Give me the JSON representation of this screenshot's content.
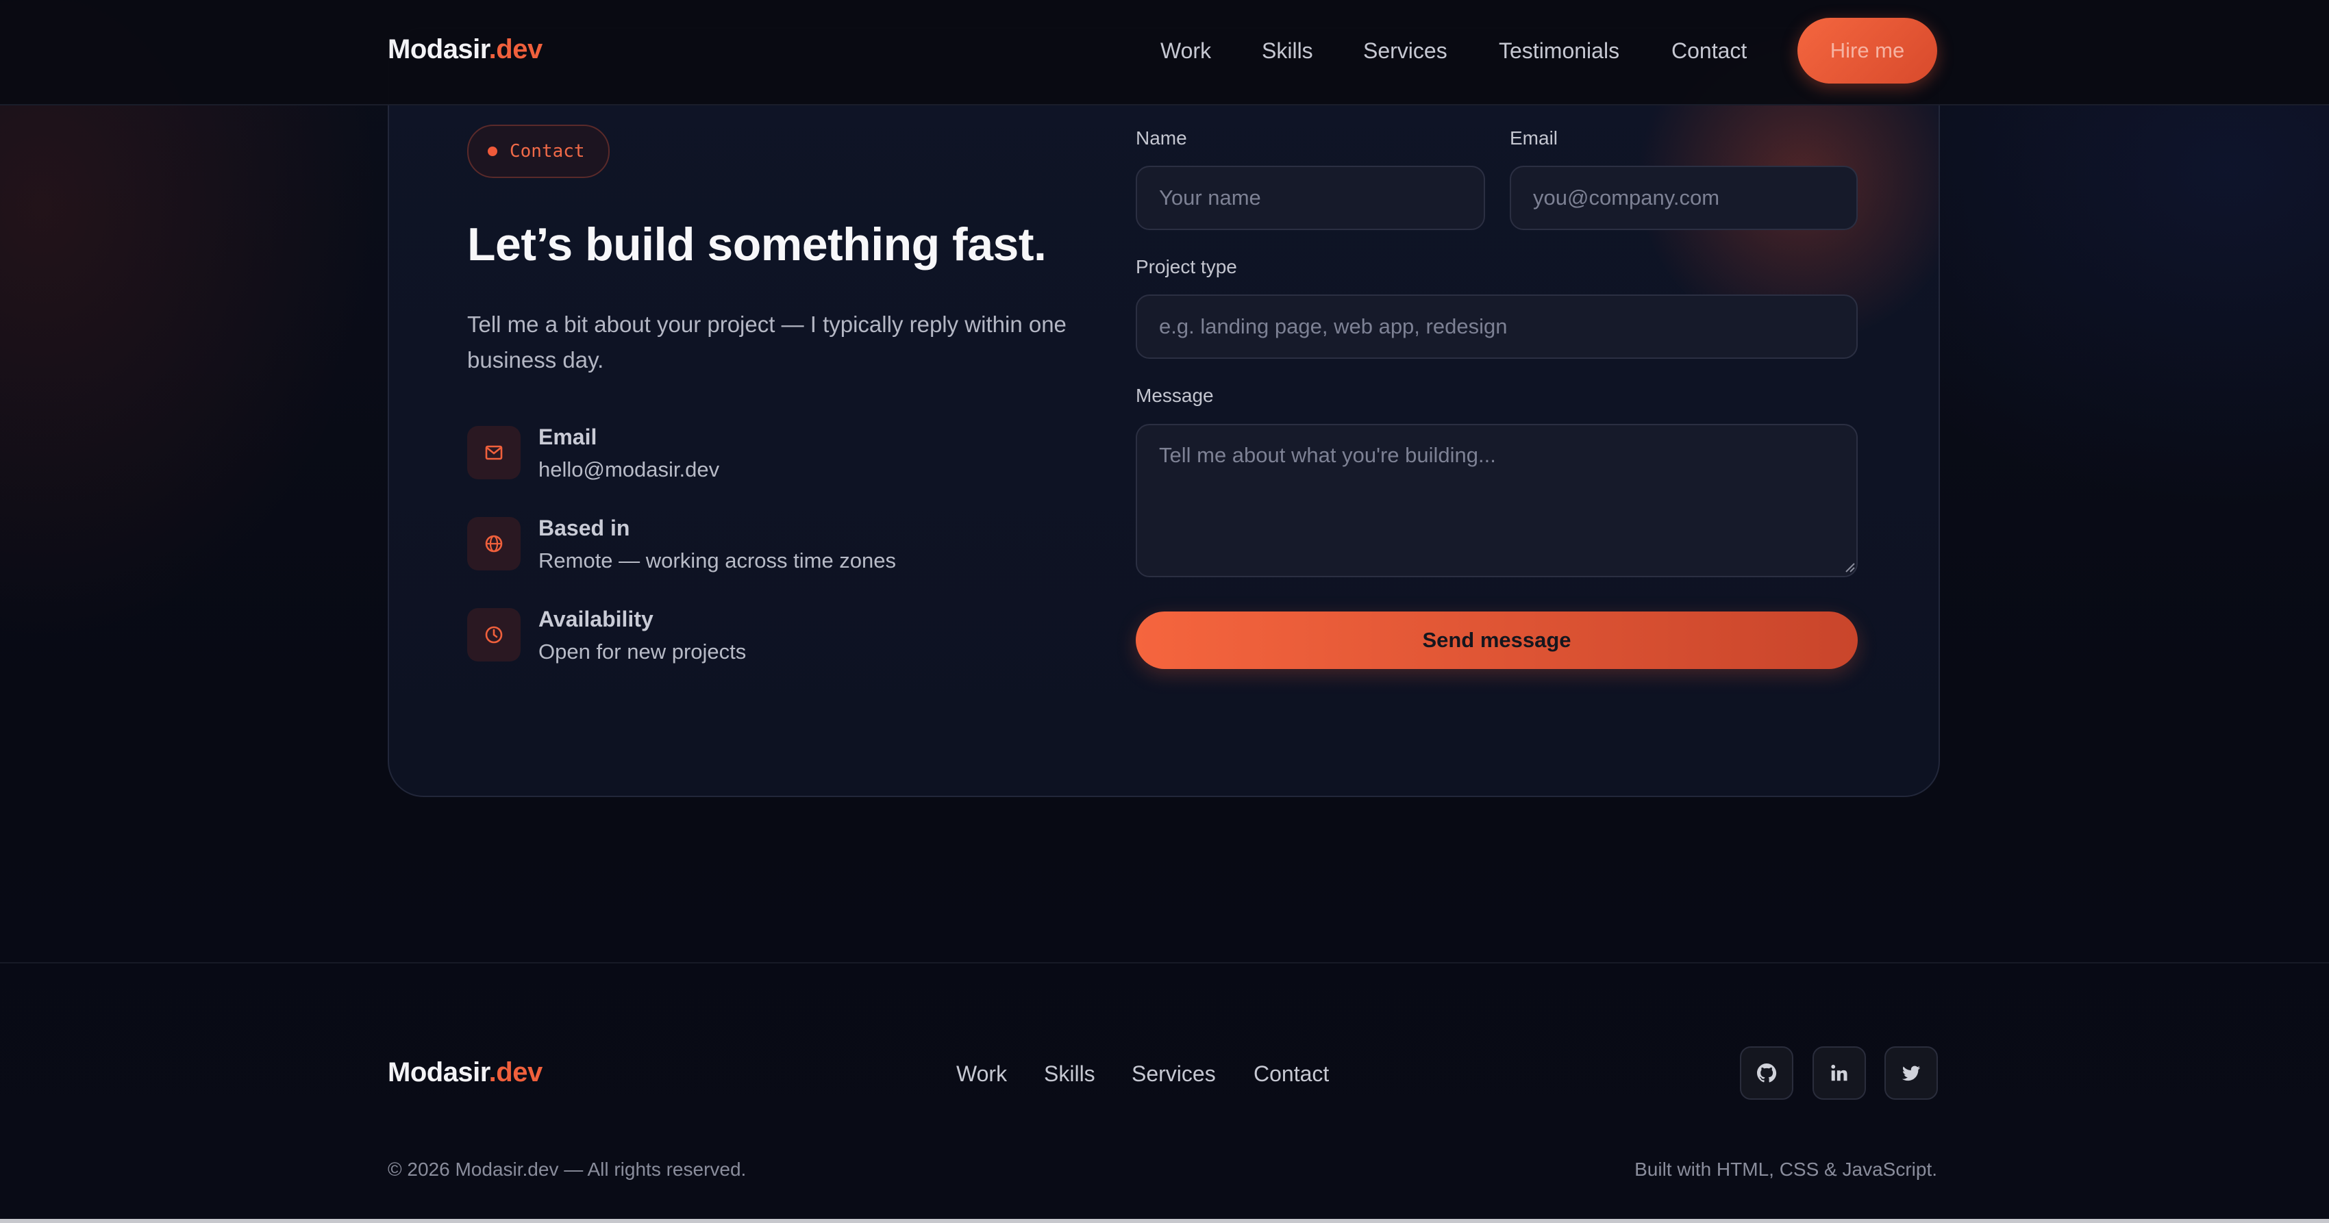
{
  "brand": {
    "name": "Modasir",
    "tld": ".dev"
  },
  "nav": {
    "links": [
      "Work",
      "Skills",
      "Services",
      "Testimonials",
      "Contact"
    ],
    "cta": "Hire me"
  },
  "contact": {
    "badge": "Contact",
    "title": "Let’s build something fast.",
    "subtitle": "Tell me a bit about your project — I typically reply within one business day.",
    "info": [
      {
        "icon": "mail-icon",
        "label": "Email",
        "value": "hello@modasir.dev"
      },
      {
        "icon": "globe-icon",
        "label": "Based in",
        "value": "Remote — working across time zones"
      },
      {
        "icon": "clock-icon",
        "label": "Availability",
        "value": "Open for new projects"
      }
    ]
  },
  "form": {
    "name": {
      "label": "Name",
      "placeholder": "Your name",
      "value": ""
    },
    "email": {
      "label": "Email",
      "placeholder": "you@company.com",
      "value": ""
    },
    "project": {
      "label": "Project type",
      "placeholder": "e.g. landing page, web app, redesign",
      "value": ""
    },
    "message": {
      "label": "Message",
      "placeholder": "Tell me about what you're building...",
      "value": ""
    },
    "submit": "Send message"
  },
  "footer": {
    "links": [
      "Work",
      "Skills",
      "Services",
      "Contact"
    ],
    "social": [
      "github-icon",
      "linkedin-icon",
      "twitter-icon"
    ],
    "copyright": "© 2026 Modasir.dev — All rights reserved.",
    "built": "Built with HTML, CSS & JavaScript."
  },
  "colors": {
    "accent": "#f0603c",
    "background": "#090b14",
    "card": "#0f1426"
  }
}
